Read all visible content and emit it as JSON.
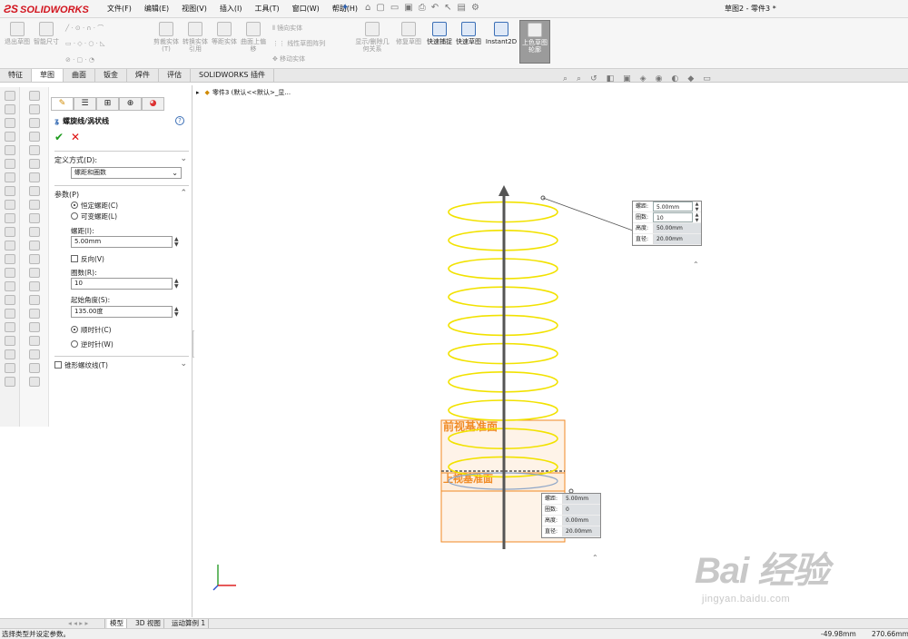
{
  "app": {
    "logo": "SOLIDWORKS",
    "title": "草图2 - 零件3 *"
  },
  "menu": [
    "文件(F)",
    "编辑(E)",
    "视图(V)",
    "插入(I)",
    "工具(T)",
    "窗口(W)",
    "帮助(H)"
  ],
  "commands": {
    "exit_sketch": "退出草图",
    "smart_dim": "智能尺寸",
    "trim": "剪裁实体(T)",
    "convert": "转换实体引用",
    "offset": "等距实体",
    "surface_offset": "曲面上偏移",
    "mirror": "镜向实体",
    "linear_pattern": "线性草图阵列",
    "move": "移动实体",
    "display_relations": "显示/删除几何关系",
    "repair": "修复草图",
    "quick_snap": "快速捕捉",
    "rapid_sketch": "快速草图",
    "instant2d": "Instant2D",
    "shaded_contours": "上色草图轮廓"
  },
  "tabs": [
    "特征",
    "草图",
    "曲面",
    "钣金",
    "焊件",
    "评估",
    "SOLIDWORKS 插件"
  ],
  "active_tab": "草图",
  "tree": {
    "item": "零件3 (默认<<默认>_显..."
  },
  "pm": {
    "title": "螺旋线/涡状线",
    "define_label": "定义方式(D):",
    "define_value": "螺距和圈数",
    "params_label": "参数(P)",
    "constant_pitch": "恒定螺距(C)",
    "variable_pitch": "可变螺距(L)",
    "pitch_label": "螺距(I):",
    "pitch_value": "5.00mm",
    "reverse": "反向(V)",
    "revs_label": "圈数(R):",
    "revs_value": "10",
    "start_angle_label": "起始角度(S):",
    "start_angle_value": "135.00度",
    "clockwise": "顺时针(C)",
    "counterclockwise": "逆时针(W)",
    "tapered": "锥形螺纹线(T)"
  },
  "callout_top": [
    {
      "k": "螺距:",
      "v": "5.00mm",
      "editable": true
    },
    {
      "k": "圈数:",
      "v": "10",
      "editable": true
    },
    {
      "k": "高度:",
      "v": "50.00mm",
      "editable": false
    },
    {
      "k": "直径:",
      "v": "20.00mm",
      "editable": false
    }
  ],
  "callout_bottom": [
    {
      "k": "螺距:",
      "v": "5.00mm"
    },
    {
      "k": "圈数:",
      "v": "0"
    },
    {
      "k": "高度:",
      "v": "0.00mm"
    },
    {
      "k": "直径:",
      "v": "20.00mm"
    }
  ],
  "planes": {
    "front": "前视基准面",
    "top": "上视基准面"
  },
  "bottom_tabs": [
    "模型",
    "3D 视图",
    "运动算例 1"
  ],
  "status": {
    "message": "选择类型并设定参数。",
    "x": "-49.98mm",
    "y": "270.66mm"
  },
  "watermark": {
    "brand": "Bai 经验",
    "url": "jingyan.baidu.com"
  },
  "colors": {
    "helix": "#f2e200",
    "plane": "#f08a24",
    "axis": "#555555",
    "accent": "#3b6fb6"
  }
}
